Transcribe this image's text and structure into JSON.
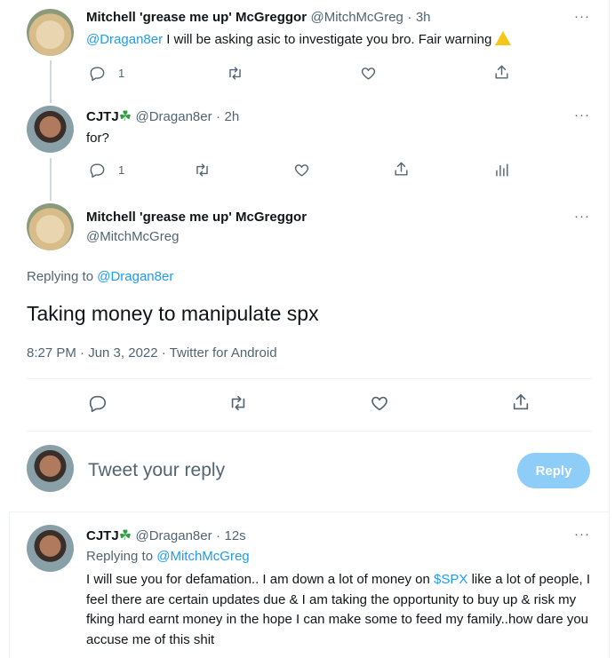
{
  "tweets": [
    {
      "display_name": "Mitchell 'grease me up' McGreggor",
      "handle": "@MitchMcGreg",
      "time": "3h",
      "mention": "@Dragan8er",
      "text": "I will be asking asic to investigate you bro. Fair warning",
      "reply_count": "1",
      "more": "···"
    },
    {
      "display_name": "CJTJ",
      "handle": "@Dragan8er",
      "time": "2h",
      "text": "for?",
      "reply_count": "1",
      "more": "···"
    }
  ],
  "main_tweet": {
    "display_name": "Mitchell 'grease me up' McGreggor",
    "handle": "@MitchMcGreg",
    "replying_to_label": "Replying to",
    "replying_to": "@Dragan8er",
    "text": "Taking money to manipulate spx",
    "timestamp": "8:27 PM · Jun 3, 2022 · Twitter for Android",
    "more": "···"
  },
  "compose": {
    "placeholder": "Tweet your reply",
    "button_label": "Reply"
  },
  "reply": {
    "display_name": "CJTJ",
    "handle": "@Dragan8er",
    "time": "12s",
    "replying_to_label": "Replying to",
    "replying_to": "@MitchMcGreg",
    "text_before": "I will sue you for defamation.. I am down a lot of money on",
    "cashtag": "$SPX",
    "text_after": "like a lot of people, I feel there are certain updates due & I am taking the opportunity to buy up & risk my fking hard earnt money in the hope I can make some to feed my family..how dare you accuse me of this shit",
    "more": "···"
  },
  "colors": {
    "accent": "#1d9bf0",
    "reply_button": "#8ecdf8",
    "text": "#0f1419",
    "secondary": "#536471"
  }
}
